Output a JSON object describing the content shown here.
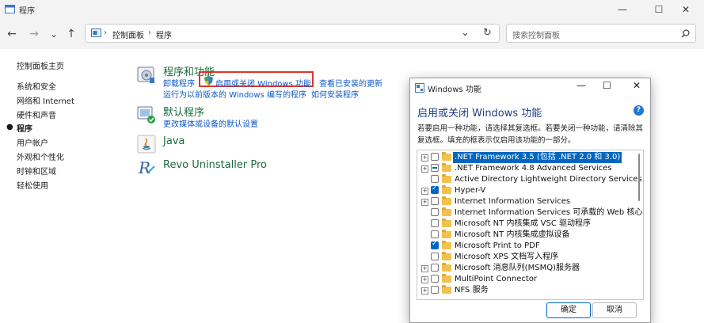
{
  "window": {
    "title": "程序",
    "minimize": "—",
    "maximize": "☐",
    "close": "✕"
  },
  "nav": {
    "back": "←",
    "forward": "→",
    "recent": "⌄",
    "up": "↑",
    "refresh": "↻",
    "dropdown": "⌄"
  },
  "address": {
    "part1": "控制面板",
    "sep": "›",
    "part2": "程序"
  },
  "search": {
    "placeholder": "搜索控制面板"
  },
  "left_nav": {
    "items": [
      "控制面板主页",
      "系统和安全",
      "网络和 Internet",
      "硬件和声音",
      "程序",
      "用户帐户",
      "外观和个性化",
      "时钟和区域",
      "轻松使用"
    ],
    "active_index": 4
  },
  "programs_features": {
    "title": "程序和功能",
    "link_uninstall": "卸载程序",
    "link_toggle_features": "启用或关闭 Windows 功能",
    "link_installed_updates": "查看已安装的更新",
    "link_run_old": "运行为以前版本的 Windows 编写的程序",
    "link_how_install": "如何安装程序"
  },
  "default_programs": {
    "title": "默认程序",
    "link": "更改媒体或设备的默认设置"
  },
  "java": {
    "title": "Java"
  },
  "revo": {
    "title": "Revo Uninstaller Pro"
  },
  "dialog": {
    "title": "Windows 功能",
    "heading": "启用或关闭 Windows 功能",
    "description": "若要启用一种功能，请选择其复选框。若要关闭一种功能，请清除其复选框。填充的框表示仅启用该功能的一部分。",
    "help": "?",
    "features": [
      {
        "label": ".NET Framework 3.5 (包括 .NET 2.0 和 3.0)",
        "expandable": true,
        "state": "unchecked",
        "selected": true
      },
      {
        "label": ".NET Framework 4.8 Advanced Services",
        "expandable": true,
        "state": "partial",
        "selected": false
      },
      {
        "label": "Active Directory Lightweight Directory Services",
        "expandable": false,
        "state": "unchecked",
        "selected": false
      },
      {
        "label": "Hyper-V",
        "expandable": true,
        "state": "checked",
        "selected": false
      },
      {
        "label": "Internet Information Services",
        "expandable": true,
        "state": "unchecked",
        "selected": false
      },
      {
        "label": "Internet Information Services 可承载的 Web 核心",
        "expandable": false,
        "state": "unchecked",
        "selected": false
      },
      {
        "label": "Microsoft NT 内核集成 VSC 驱动程序",
        "expandable": false,
        "state": "unchecked",
        "selected": false
      },
      {
        "label": "Microsoft NT 内核集成虚拟设备",
        "expandable": false,
        "state": "unchecked",
        "selected": false
      },
      {
        "label": "Microsoft Print to PDF",
        "expandable": false,
        "state": "checked",
        "selected": false
      },
      {
        "label": "Microsoft XPS 文档写入程序",
        "expandable": false,
        "state": "unchecked",
        "selected": false
      },
      {
        "label": "Microsoft 消息队列(MSMQ)服务器",
        "expandable": true,
        "state": "unchecked",
        "selected": false
      },
      {
        "label": "MultiPoint Connector",
        "expandable": true,
        "state": "unchecked",
        "selected": false
      },
      {
        "label": "NFS 服务",
        "expandable": true,
        "state": "unchecked",
        "selected": false
      }
    ],
    "ok": "确定",
    "cancel": "取消"
  },
  "colors": {
    "accent": "#0067c0",
    "link": "#0b57c8",
    "section_title": "#1b6b3e",
    "highlight_box": "#e0352b"
  }
}
